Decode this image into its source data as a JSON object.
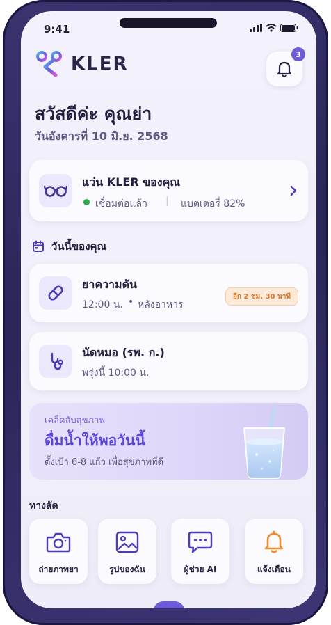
{
  "status_bar": {
    "time": "9:41"
  },
  "brand": {
    "name": "KLER"
  },
  "notifications": {
    "count": "3"
  },
  "greeting": {
    "title": "สวัสดีค่ะ คุณย่า",
    "date": "วันอังคารที่ 10 มิ.ย. 2568"
  },
  "device": {
    "title": "แว่น KLER ของคุณ",
    "status": "เชื่อมต่อแล้ว",
    "separator": "|",
    "battery": "แบตเตอรี่ 82%"
  },
  "today": {
    "section_title": "วันนี้ของคุณ",
    "items": [
      {
        "title": "ยาความดัน",
        "time": "12:00 น.",
        "dot": "•",
        "note": "หลังอาหาร",
        "badge": "อีก 2 ชม. 30 นาที"
      },
      {
        "title": "นัดหมอ (รพ. ก.)",
        "time": "พรุ่งนี้ 10:00 น."
      }
    ]
  },
  "health_tip": {
    "label": "เคล็ดลับสุขภาพ",
    "title": "ดื่มน้ำให้พอวันนี้",
    "description": "ตั้งเป้า 6-8 แก้ว เพื่อสุขภาพที่ดี"
  },
  "shortcuts": {
    "title": "ทางลัด",
    "items": [
      {
        "label": "ถ่ายภาพยา",
        "icon": "camera-icon"
      },
      {
        "label": "รูปของฉัน",
        "icon": "image-icon"
      },
      {
        "label": "ผู้ช่วย AI",
        "icon": "chat-icon"
      },
      {
        "label": "แจ้งเตือน",
        "icon": "bell-icon"
      }
    ]
  },
  "colors": {
    "accent": "#6b5bd6",
    "connected": "#2fa84f",
    "badge_bg": "#fde9d7",
    "badge_text": "#d8752a",
    "alert_icon": "#f08a2c"
  }
}
